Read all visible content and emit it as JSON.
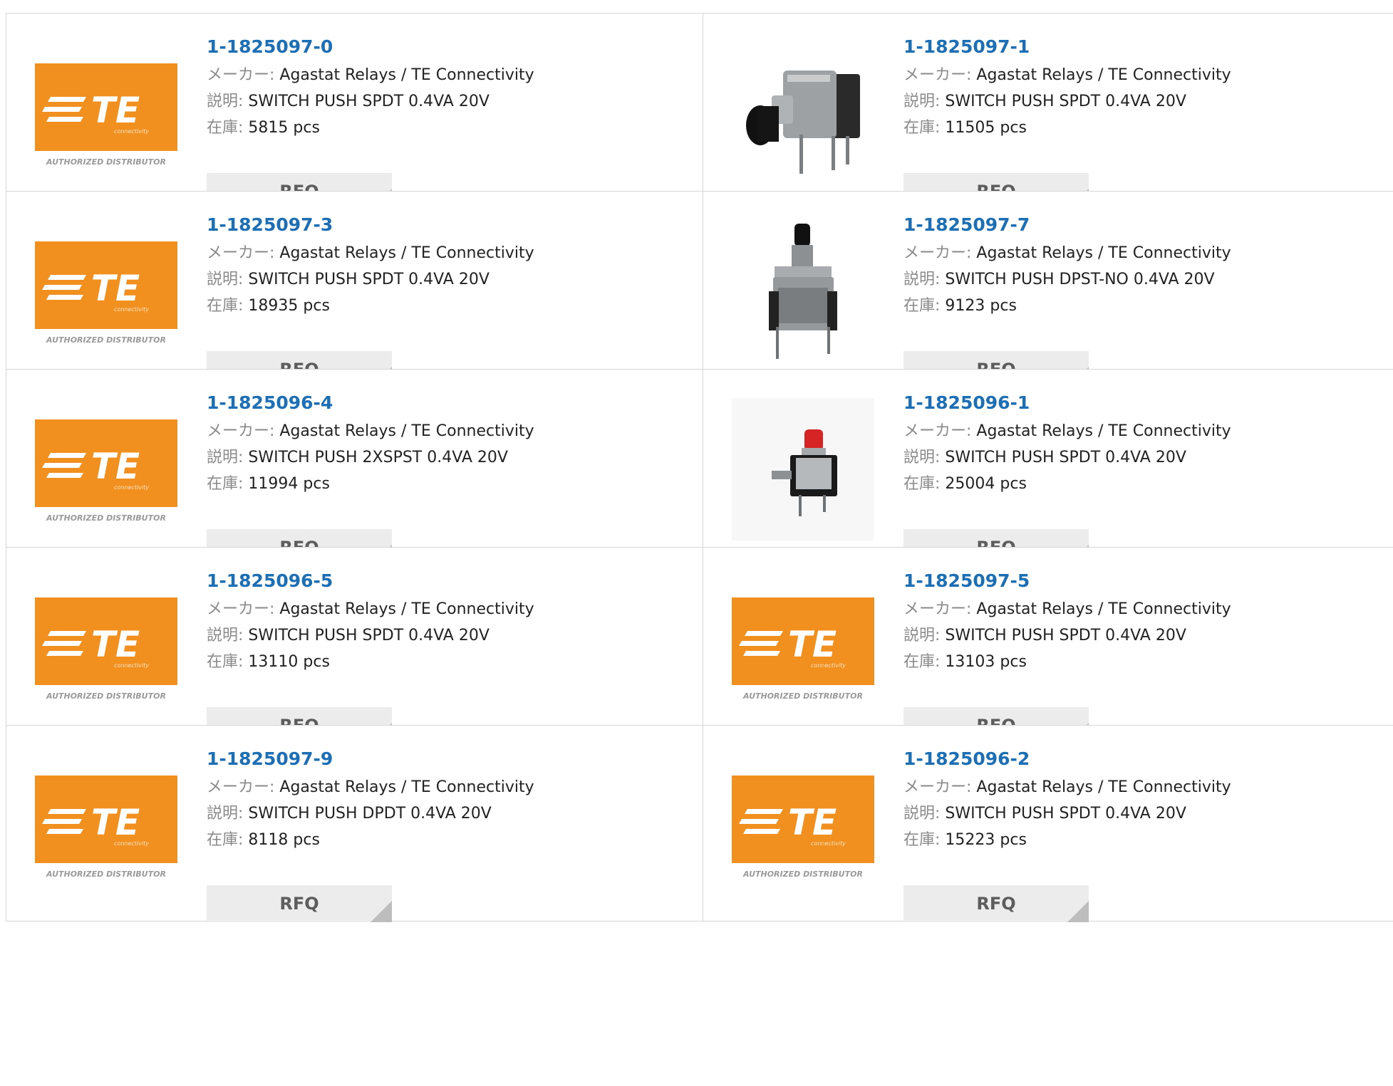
{
  "labels": {
    "maker": "メーカー:",
    "description": "説明:",
    "stock": "在庫:",
    "rfq": "RFQ"
  },
  "te_logo": {
    "text": "TE",
    "sub": "connectivity",
    "caption": "AUTHORIZED DISTRIBUTOR",
    "color": "#f2901f"
  },
  "accent_color": "#1d6fb5",
  "products": [
    {
      "part": "1-1825097-0",
      "maker": "Agastat Relays / TE Connectivity",
      "description": "SWITCH PUSH SPDT 0.4VA 20V",
      "stock": "5815 pcs",
      "image": "te-logo"
    },
    {
      "part": "1-1825097-1",
      "maker": "Agastat Relays / TE Connectivity",
      "description": "SWITCH PUSH SPDT 0.4VA 20V",
      "stock": "11505 pcs",
      "image": "right-angle-black-switch"
    },
    {
      "part": "1-1825097-3",
      "maker": "Agastat Relays / TE Connectivity",
      "description": "SWITCH PUSH SPDT 0.4VA 20V",
      "stock": "18935 pcs",
      "image": "te-logo"
    },
    {
      "part": "1-1825097-7",
      "maker": "Agastat Relays / TE Connectivity",
      "description": "SWITCH PUSH DPST-NO 0.4VA 20V",
      "stock": "9123 pcs",
      "image": "vertical-black-switch"
    },
    {
      "part": "1-1825096-4",
      "maker": "Agastat Relays / TE Connectivity",
      "description": "SWITCH PUSH 2XSPST 0.4VA 20V",
      "stock": "11994 pcs",
      "image": "te-logo"
    },
    {
      "part": "1-1825096-1",
      "maker": "Agastat Relays / TE Connectivity",
      "description": "SWITCH PUSH SPDT 0.4VA 20V",
      "stock": "25004 pcs",
      "image": "red-cap-switch"
    },
    {
      "part": "1-1825096-5",
      "maker": "Agastat Relays / TE Connectivity",
      "description": "SWITCH PUSH SPDT 0.4VA 20V",
      "stock": "13110 pcs",
      "image": "te-logo"
    },
    {
      "part": "1-1825097-5",
      "maker": "Agastat Relays / TE Connectivity",
      "description": "SWITCH PUSH SPDT 0.4VA 20V",
      "stock": "13103 pcs",
      "image": "te-logo"
    },
    {
      "part": "1-1825097-9",
      "maker": "Agastat Relays / TE Connectivity",
      "description": "SWITCH PUSH DPDT 0.4VA 20V",
      "stock": "8118 pcs",
      "image": "te-logo"
    },
    {
      "part": "1-1825096-2",
      "maker": "Agastat Relays / TE Connectivity",
      "description": "SWITCH PUSH SPDT 0.4VA 20V",
      "stock": "15223 pcs",
      "image": "te-logo"
    }
  ]
}
